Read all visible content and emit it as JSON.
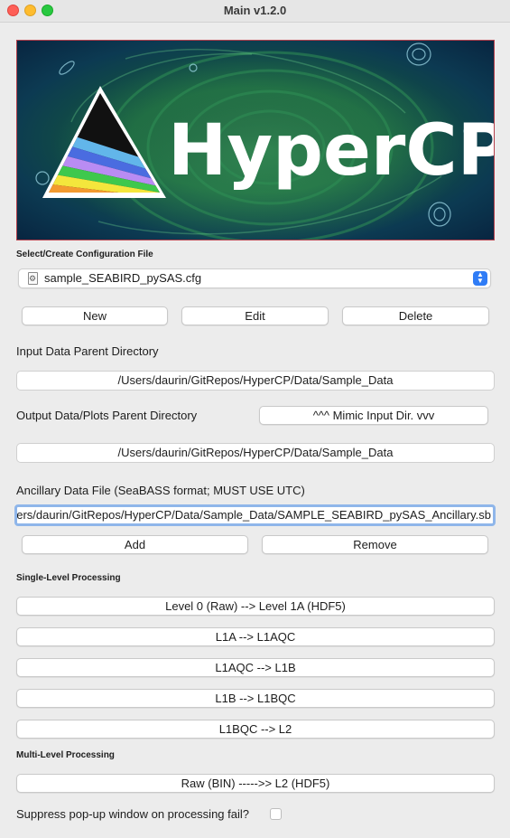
{
  "window": {
    "title": "Main v1.2.0"
  },
  "banner": {
    "logo_text": "HyperCP"
  },
  "config": {
    "section_label": "Select/Create Configuration File",
    "selected_file": "sample_SEABIRD_pySAS.cfg",
    "new_label": "New",
    "edit_label": "Edit",
    "delete_label": "Delete"
  },
  "input_dir": {
    "label": "Input Data Parent Directory",
    "path": "/Users/daurin/GitRepos/HyperCP/Data/Sample_Data"
  },
  "output_dir": {
    "label": "Output Data/Plots Parent Directory",
    "mimic_label": "^^^ Mimic Input Dir. vvv",
    "path": "/Users/daurin/GitRepos/HyperCP/Data/Sample_Data"
  },
  "ancillary": {
    "label": "Ancillary Data File (SeaBASS format; MUST USE UTC)",
    "path": "/Users/daurin/GitRepos/HyperCP/Data/Sample_Data/SAMPLE_SEABIRD_pySAS_Ancillary.sb",
    "add_label": "Add",
    "remove_label": "Remove"
  },
  "single_level": {
    "section_label": "Single-Level Processing",
    "buttons": [
      "Level 0 (Raw) --> Level 1A (HDF5)",
      "L1A --> L1AQC",
      "L1AQC --> L1B",
      "L1B --> L1BQC",
      "L1BQC --> L2"
    ]
  },
  "multi_level": {
    "section_label": "Multi-Level Processing",
    "button": "Raw (BIN) ----->> L2 (HDF5)"
  },
  "suppress": {
    "label": "Suppress pop-up window on processing fail?",
    "checked": false
  },
  "colors": {
    "accent": "#2f7cf6",
    "focus_ring": "#8fb6ea",
    "banner_border": "#b4404c"
  }
}
